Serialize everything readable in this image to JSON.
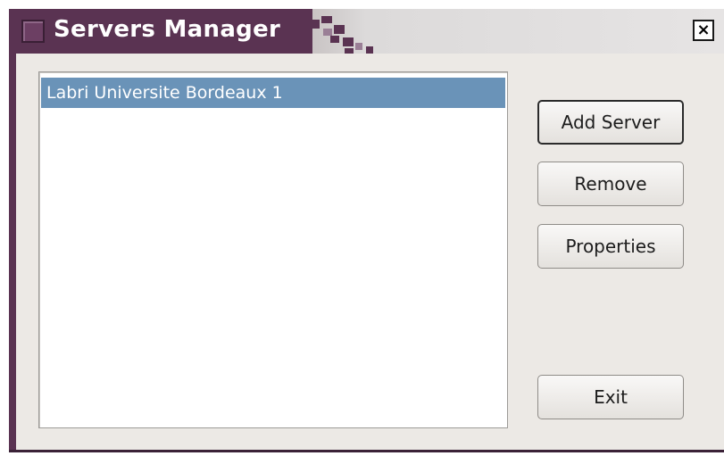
{
  "window": {
    "title": "Servers Manager",
    "close_glyph": "×",
    "icons": {
      "window_menu": "window-menu-icon",
      "close": "close-icon"
    }
  },
  "servers": {
    "items": [
      "Labri Universite Bordeaux 1"
    ],
    "selected_index": 0
  },
  "buttons": {
    "add_server": "Add Server",
    "remove": "Remove",
    "properties": "Properties",
    "exit": "Exit"
  },
  "colors": {
    "titlebar": "#5a3352",
    "selection": "#6a93b8",
    "dialog_bg": "#ece9e5"
  }
}
